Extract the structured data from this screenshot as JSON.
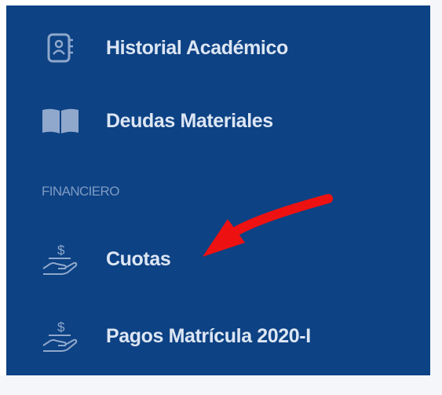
{
  "sidebar": {
    "items": [
      {
        "label": "Historial Académico",
        "icon": "student-record-icon"
      },
      {
        "label": "Deudas Materiales",
        "icon": "book-icon"
      }
    ],
    "section_title": "FINANCIERO",
    "financial_items": [
      {
        "label": "Cuotas",
        "icon": "hand-dollar-icon"
      },
      {
        "label": "Pagos Matrícula 2020-I",
        "icon": "hand-dollar-icon"
      }
    ]
  },
  "annotation": {
    "arrow_color": "#ee1111",
    "target": "Cuotas"
  },
  "colors": {
    "sidebar_bg": "#0d4284",
    "text": "#dde6f3",
    "section_text": "#7f9bc4",
    "icon": "#8fa8cc"
  }
}
